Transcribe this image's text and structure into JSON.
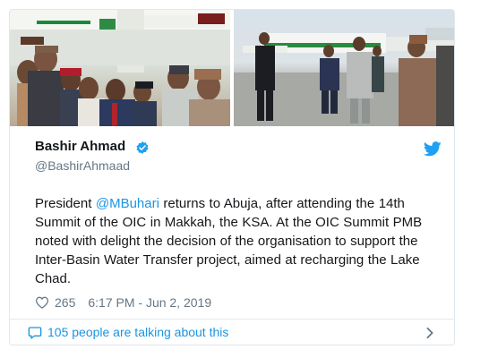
{
  "tweet": {
    "author_name": "Bashir Ahmad",
    "author_handle": "@BashirAhmaad",
    "verified": true,
    "text_before": "President ",
    "mention": "@MBuhari",
    "text_after": " returns to Abuja, after attending the 14th Summit of the OIC in Makkah, the KSA. At the OIC Summit PMB noted with delight the decision of the organisation to support the Inter-Basin Water Transfer project, aimed at recharging the Lake Chad.",
    "like_count": "265",
    "timestamp": "6:17 PM - Jun 2, 2019",
    "talking_text": "105 people are talking about this"
  },
  "icons": {
    "verified": "verified-badge-icon",
    "platform": "twitter-bird-icon",
    "like": "heart-icon",
    "talking": "speech-bubble-icon",
    "more": "chevron-right-icon"
  },
  "colors": {
    "link": "#1b95e0",
    "secondary_text": "#657786",
    "primary_text": "#14171a",
    "border": "#e1e8ed"
  }
}
